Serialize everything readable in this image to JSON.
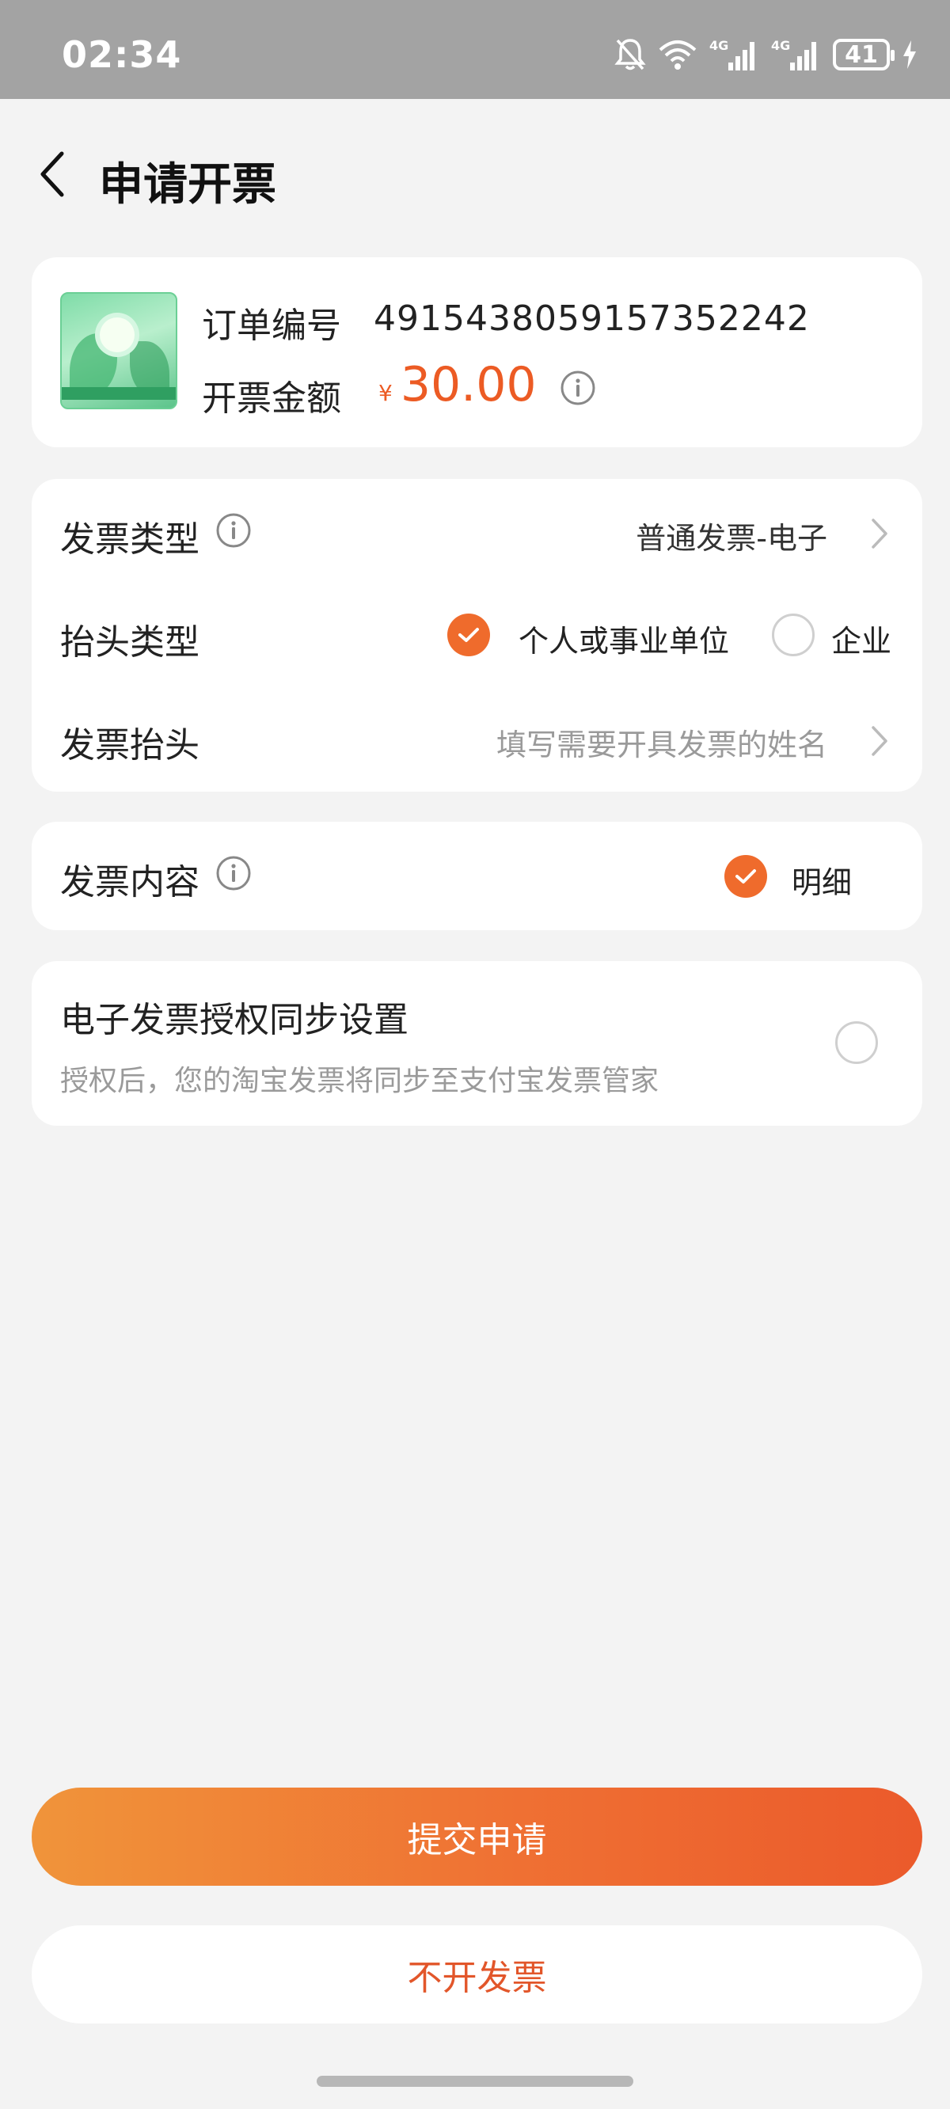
{
  "status_bar": {
    "time": "02:34",
    "battery": "41",
    "icons": [
      "bell-muted-icon",
      "wifi-icon",
      "signal-4g-icon",
      "signal-4g-icon",
      "battery-icon",
      "charging-icon"
    ]
  },
  "header": {
    "title": "申请开票"
  },
  "order": {
    "order_no_label": "订单编号",
    "order_no": "4915438059157352242",
    "amount_label": "开票金额",
    "currency": "¥",
    "amount": "30.00"
  },
  "invoice": {
    "type_label": "发票类型",
    "type_value": "普通发票-电子",
    "title_type_label": "抬头类型",
    "options": [
      {
        "label": "个人或事业单位",
        "checked": true
      },
      {
        "label": "企业",
        "checked": false
      }
    ],
    "title_label": "发票抬头",
    "title_placeholder": "填写需要开具发票的姓名"
  },
  "content": {
    "label": "发票内容",
    "option": "明细",
    "checked": true
  },
  "sync": {
    "title": "电子发票授权同步设置",
    "desc": "授权后，您的淘宝发票将同步至支付宝发票管家",
    "checked": false
  },
  "actions": {
    "submit_label": "提交申请",
    "skip_label": "不开发票"
  },
  "colors": {
    "accent": "#ef6b2c",
    "price": "#ec5b24",
    "status_bar": "#a3a3a3"
  }
}
